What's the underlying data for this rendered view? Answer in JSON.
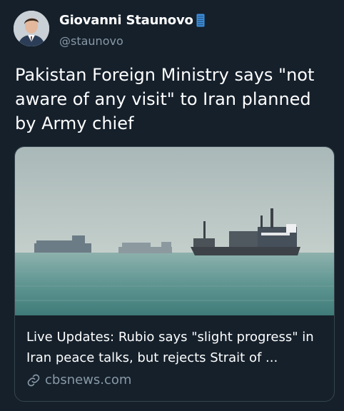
{
  "author": {
    "display_name": "Giovanni Staunovo",
    "handle": "@staunovo",
    "avatar_icon": "profile-photo",
    "badge_icon": "smartphone-badge-icon"
  },
  "tweet": {
    "text": "Pakistan Foreign Ministry says \"not aware of any visit\" to Iran planned by Army chief"
  },
  "card": {
    "image_icon": "ships-at-sea-photo",
    "title": "Live Updates: Rubio says \"slight progress\" in Iran peace talks, but rejects Strait of ...",
    "domain": "cbsnews.com",
    "link_icon": "link-icon"
  },
  "colors": {
    "background": "#15202b",
    "text": "#ffffff",
    "secondary_text": "#8899a6",
    "border": "#38444d",
    "badge": "#3b8fde"
  }
}
